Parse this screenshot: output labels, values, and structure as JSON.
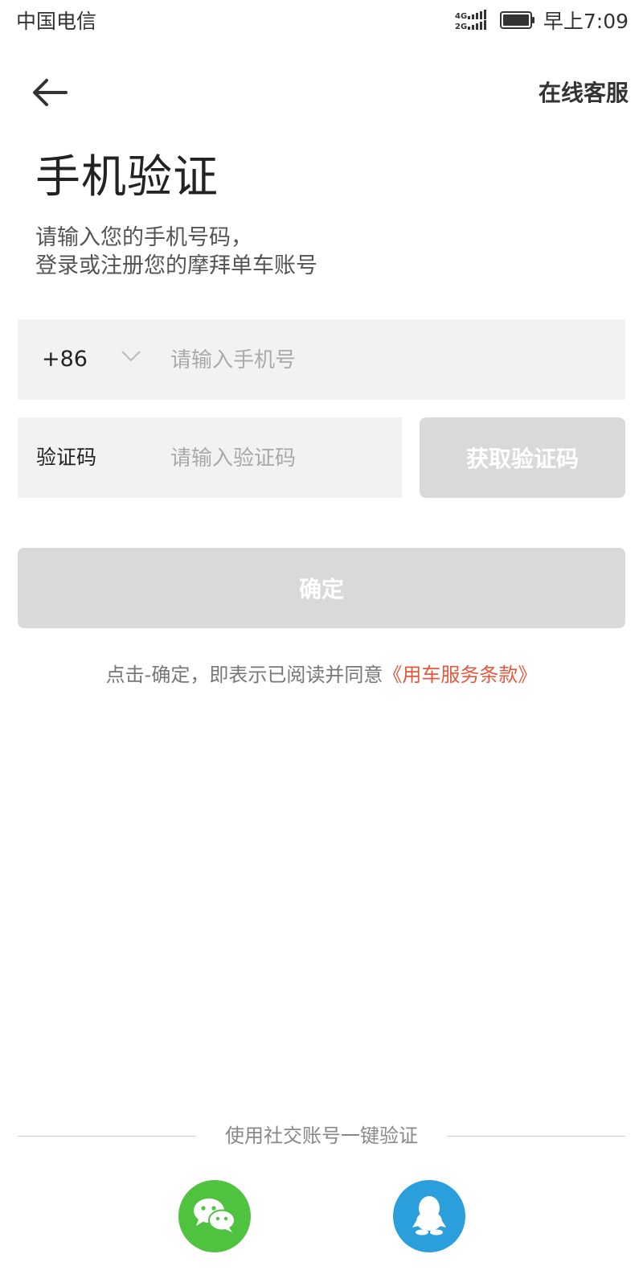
{
  "status_bar": {
    "carrier": "中国电信",
    "time": "早上7:09",
    "signal_icon": "signal-icon",
    "battery_icon": "battery-icon"
  },
  "header": {
    "back_icon": "arrow-left-icon",
    "customer_service": "在线客服"
  },
  "title": "手机验证",
  "subtitle": {
    "line1": "请输入您的手机号码，",
    "line2": "登录或注册您的摩拜单车账号"
  },
  "phone": {
    "country_code": "+86",
    "placeholder": "请输入手机号",
    "value": ""
  },
  "code": {
    "label": "验证码",
    "placeholder": "请输入验证码",
    "value": "",
    "get_code_label": "获取验证码"
  },
  "confirm_label": "确定",
  "terms": {
    "prefix": "点击-确定，即表示已阅读并同意",
    "link": "《用车服务条款》"
  },
  "social": {
    "label": "使用社交账号一键验证",
    "wechat_icon": "wechat-icon",
    "qq_icon": "qq-icon"
  },
  "colors": {
    "accent": "#e8573d",
    "disabled_button": "#d9d9d9",
    "wechat": "#4fc23f",
    "qq": "#2b9fdc",
    "input_bg": "#f2f2f2"
  }
}
